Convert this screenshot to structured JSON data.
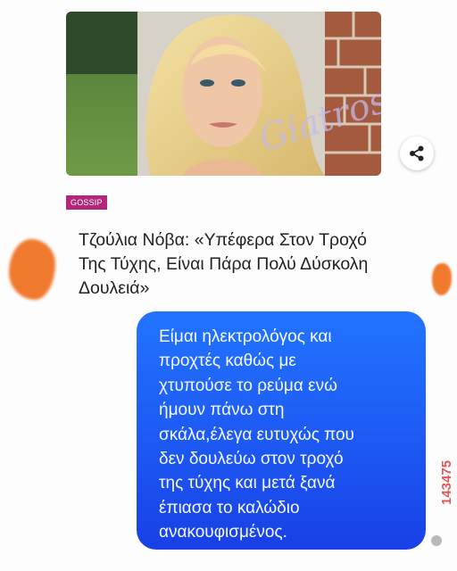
{
  "article": {
    "category": "GOSSIP",
    "headline": "Τζούλια Νόβα: «Υπέφερα Στον Τροχό Της Τύχης, Είναι Πάρα Πολύ Δύσκολη Δουλειά»",
    "watermark": "Giatros sou",
    "share_icon": "share-icon",
    "category_color": "#b3267a"
  },
  "message": {
    "lines": [
      "Είμαι ηλεκτρολόγος και",
      "προχτές καθώς με",
      "χτυπούσε το ρεύμα ενώ",
      "ήμουν πάνω στη",
      "σκάλα,έλεγα ευτυχώς που",
      "δεν δουλεύω στον τροχό",
      "της τύχης και μετά ξανά",
      "έπιασα το καλώδιο",
      "ανακουφισμένος."
    ],
    "bubble_color": "#1d59f3"
  },
  "post_id": "143475",
  "colors": {
    "redaction": "#ef7a2e",
    "id_text": "#e25656"
  }
}
